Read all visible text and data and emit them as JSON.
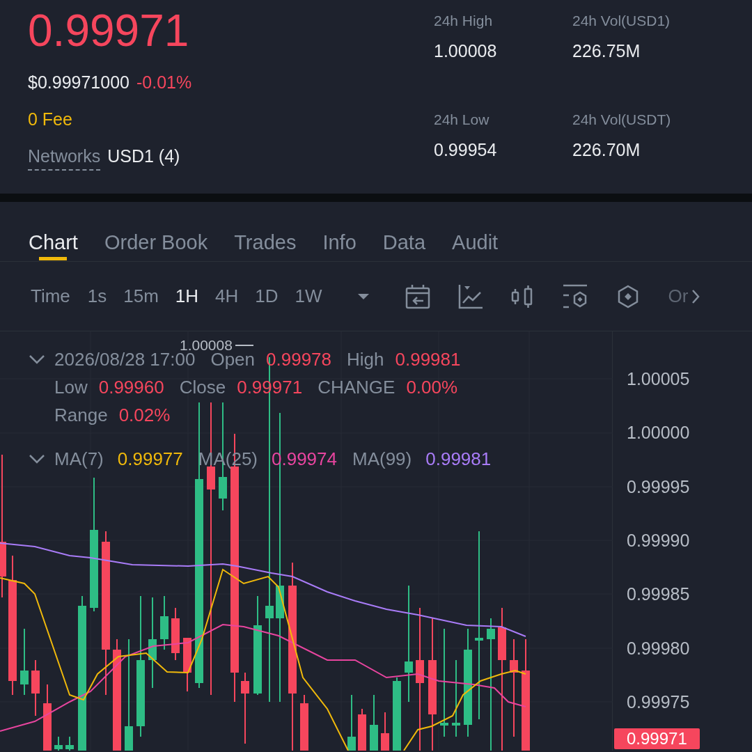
{
  "ticker": {
    "price": "0.99971",
    "usd_price": "$0.99971000",
    "change": "-0.01%",
    "fee": "0 Fee",
    "networks_label": "Networks",
    "networks_value": "USD1 (4)"
  },
  "stats": [
    {
      "label": "24h High",
      "value": "1.00008"
    },
    {
      "label": "24h Vol(USD1)",
      "value": "226.75M"
    },
    {
      "label": "24h Low",
      "value": "0.99954"
    },
    {
      "label": "24h Vol(USDT)",
      "value": "226.70M"
    }
  ],
  "tabs": [
    {
      "label": "Chart",
      "selected": true
    },
    {
      "label": "Order Book",
      "selected": false
    },
    {
      "label": "Trades",
      "selected": false
    },
    {
      "label": "Info",
      "selected": false
    },
    {
      "label": "Data",
      "selected": false
    },
    {
      "label": "Audit",
      "selected": false
    }
  ],
  "toolbar": {
    "time_label": "Time",
    "intervals": [
      {
        "label": "1s",
        "selected": false
      },
      {
        "label": "15m",
        "selected": false
      },
      {
        "label": "1H",
        "selected": true
      },
      {
        "label": "4H",
        "selected": false
      },
      {
        "label": "1D",
        "selected": false
      },
      {
        "label": "1W",
        "selected": false
      }
    ],
    "overflow_label": "Or"
  },
  "chart": {
    "high_marker": "1.00008",
    "legend": {
      "expanded": true,
      "date": "2026/08/28 17:00",
      "fields": [
        {
          "label": "Open",
          "value": "0.99978"
        },
        {
          "label": "High",
          "value": "0.99981"
        },
        {
          "label": "Low",
          "value": "0.99960"
        },
        {
          "label": "Close",
          "value": "0.99971"
        },
        {
          "label": "CHANGE",
          "value": "0.00%"
        },
        {
          "label": "Range",
          "value": "0.02%"
        }
      ]
    },
    "ma_legend": {
      "expanded": true,
      "items": [
        {
          "label": "MA(7)",
          "value": "0.99977",
          "color": "#f0b90b"
        },
        {
          "label": "MA(25)",
          "value": "0.99974",
          "color": "#e8459f"
        },
        {
          "label": "MA(99)",
          "value": "0.99981",
          "color": "#a97cf8"
        }
      ]
    },
    "price_axis": [
      "1.00005",
      "1.00000",
      "0.99995",
      "0.99990",
      "0.99985",
      "0.99980",
      "0.99975"
    ],
    "current_price": "0.99971"
  }
}
